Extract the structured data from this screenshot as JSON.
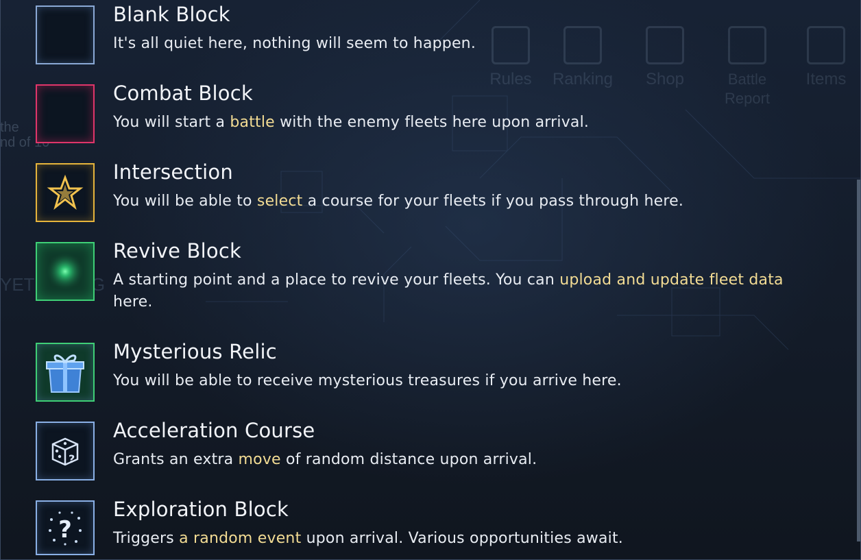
{
  "background_ghost": {
    "menu": [
      "Rules",
      "Ranking",
      "Shop",
      "Battle Report",
      "Items"
    ],
    "left_text": [
      "the",
      "nd of 10"
    ],
    "left_label": "YETIBOBOG"
  },
  "colors": {
    "highlight": "#f3dc94",
    "blank_border": "#8aa9d6",
    "combat_border": "#e0356a",
    "intersection_border": "#e6b43c",
    "revive_border": "#3fcf76"
  },
  "blocks": [
    {
      "title": "Blank Block",
      "icon": "blank-square-icon",
      "desc": [
        "It's all quiet here, nothing will seem to happen."
      ]
    },
    {
      "title": "Combat Block",
      "icon": "combat-square-icon",
      "desc": [
        "You will start a ",
        "battle",
        " with the enemy fleets here upon arrival."
      ]
    },
    {
      "title": "Intersection",
      "icon": "star-icon",
      "desc": [
        "You will be able to ",
        "select",
        " a course for your fleets if you pass through here."
      ]
    },
    {
      "title": "Revive Block",
      "icon": "green-glow-icon",
      "desc": [
        "A starting point and a place to revive your fleets. You can ",
        "upload and update fleet data",
        " here."
      ]
    },
    {
      "title": "Mysterious Relic",
      "icon": "gift-box-icon",
      "desc": [
        "You will be able to receive mysterious treasures if you arrive here."
      ]
    },
    {
      "title": "Acceleration Course",
      "icon": "dice-icon",
      "desc": [
        "Grants an extra ",
        "move",
        " of random distance upon arrival."
      ]
    },
    {
      "title": "Exploration Block",
      "icon": "question-mark-icon",
      "desc": [
        "Triggers ",
        "a random event",
        " upon arrival. Various opportunities await."
      ]
    }
  ]
}
